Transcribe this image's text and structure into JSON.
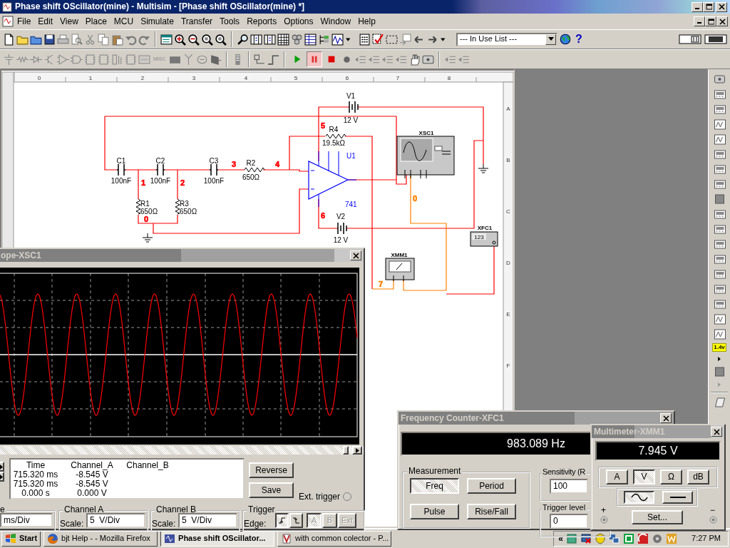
{
  "window": {
    "title": "Phase shift OScillator(mine) - Multisim - [Phase shift OScillator(mine) *]"
  },
  "menu": [
    "File",
    "Edit",
    "View",
    "Place",
    "MCU",
    "Simulate",
    "Transfer",
    "Tools",
    "Reports",
    "Options",
    "Window",
    "Help"
  ],
  "in_use_list": {
    "value": "--- In Use List ---"
  },
  "help_button": "?",
  "component_toolbar": {
    "misc_label": "MISC"
  },
  "simulation_controls": [
    {
      "kind": "run",
      "pressed": false
    },
    {
      "kind": "pause",
      "pressed": true
    },
    {
      "kind": "stop",
      "pressed": false
    }
  ],
  "ruler": {
    "columns": [
      "0",
      "1",
      "2",
      "3",
      "4",
      "5",
      "6",
      "7",
      "8"
    ],
    "rows": [
      "A",
      "B",
      "C",
      "D",
      "E",
      "F"
    ]
  },
  "schematic": {
    "components": [
      {
        "kind": "battery",
        "name": "V1",
        "value": "12 V"
      },
      {
        "kind": "resistor",
        "name": "R4",
        "value": "19.5kΩ"
      },
      {
        "kind": "opamp",
        "name": "U1",
        "value": "741"
      },
      {
        "kind": "capacitor",
        "name": "C1",
        "value": "100nF"
      },
      {
        "kind": "capacitor",
        "name": "C2",
        "value": "100nF"
      },
      {
        "kind": "capacitor",
        "name": "C3",
        "value": "100nF"
      },
      {
        "kind": "resistor",
        "name": "R2",
        "value": "650Ω"
      },
      {
        "kind": "resistor",
        "name": "R1",
        "value": "650Ω"
      },
      {
        "kind": "resistor",
        "name": "R3",
        "value": "650Ω"
      },
      {
        "kind": "battery",
        "name": "V2",
        "value": "12 V"
      },
      {
        "kind": "oscilloscope",
        "name": "XSC1"
      },
      {
        "kind": "counter",
        "name": "XFC1",
        "display": "123"
      },
      {
        "kind": "multimeter",
        "name": "XMM1"
      }
    ],
    "nets": [
      {
        "label": "1",
        "color": "#ff0000"
      },
      {
        "label": "2",
        "color": "#ff0000"
      },
      {
        "label": "3",
        "color": "#ff0000"
      },
      {
        "label": "4",
        "color": "#ff0000"
      },
      {
        "label": "5",
        "color": "#ff0000"
      },
      {
        "label": "6",
        "color": "#ff0000"
      },
      {
        "label": "0",
        "color": "#ff0000"
      },
      {
        "label": "0",
        "color": "#ff8000"
      },
      {
        "label": "7",
        "color": "#ff8000"
      }
    ]
  },
  "oscilloscope": {
    "title": "ope-XSC1",
    "readout": {
      "columns": [
        "Time",
        "Channel_A",
        "Channel_B"
      ],
      "rows": [
        {
          "time": "715.320 ms",
          "channel_a": "-8.545 V"
        },
        {
          "time": "715.320 ms",
          "channel_a": "-8.545 V"
        },
        {
          "time": "0.000 s",
          "channel_a": "0.000 V"
        }
      ]
    },
    "buttons": [
      "Reverse",
      "Save"
    ],
    "ext_trigger": {
      "label": "Ext. trigger",
      "checked": false
    },
    "timebase": {
      "label": "e",
      "scale": "ms/Div"
    },
    "channel_a": {
      "label": "Channel A",
      "scale_label": "Scale:",
      "scale": "5  V/Div"
    },
    "channel_b": {
      "label": "Channel B",
      "scale_label": "Scale:",
      "scale": "5  V/Div"
    },
    "trigger": {
      "label": "Trigger",
      "edge_label": "Edge:",
      "edges": [
        {
          "kind": "rising",
          "selected": true
        },
        {
          "kind": "falling",
          "selected": false
        }
      ],
      "sources": [
        {
          "label": "A",
          "selected": true,
          "disabled": true
        },
        {
          "label": "B",
          "selected": false,
          "disabled": true
        },
        {
          "label": "Ext",
          "selected": false,
          "disabled": true
        }
      ]
    }
  },
  "frequency_counter": {
    "title": "Frequency Counter-XFC1",
    "display": "983.089 Hz",
    "measurement": {
      "label": "Measurement",
      "buttons": [
        {
          "label": "Freq",
          "selected": true
        },
        {
          "label": "Period",
          "selected": false
        },
        {
          "label": "Pulse",
          "selected": false
        },
        {
          "label": "Rise/Fall",
          "selected": false
        }
      ]
    },
    "sensitivity": {
      "label": "Sensitivity (R",
      "value": "100"
    },
    "trigger_level": {
      "label": "Trigger level",
      "value": "0"
    }
  },
  "multimeter": {
    "title": "Multimeter-XMM1",
    "display": "7.945 V",
    "modes": [
      {
        "label": "A",
        "selected": false
      },
      {
        "label": "V",
        "selected": true
      },
      {
        "label": "Ω",
        "selected": false
      },
      {
        "label": "dB",
        "selected": false
      }
    ],
    "signals": [
      {
        "kind": "ac",
        "selected": true
      },
      {
        "kind": "dc",
        "selected": false
      }
    ],
    "set_button": "Set...",
    "terminals": [
      "+",
      "−"
    ]
  },
  "instrument_toolbar": {
    "probe_label": "1.4v"
  },
  "taskbar": {
    "start": "Start",
    "tray_expander": "«",
    "clock": "7:27 PM",
    "tasks": [
      {
        "kind": "firefox",
        "label": "bjt Help - - Mozilla Firefox",
        "active": false
      },
      {
        "kind": "multisim",
        "label": "Phase shift OScillator...",
        "active": true
      },
      {
        "kind": "document",
        "label": "with common colector - P...",
        "active": false
      }
    ]
  }
}
